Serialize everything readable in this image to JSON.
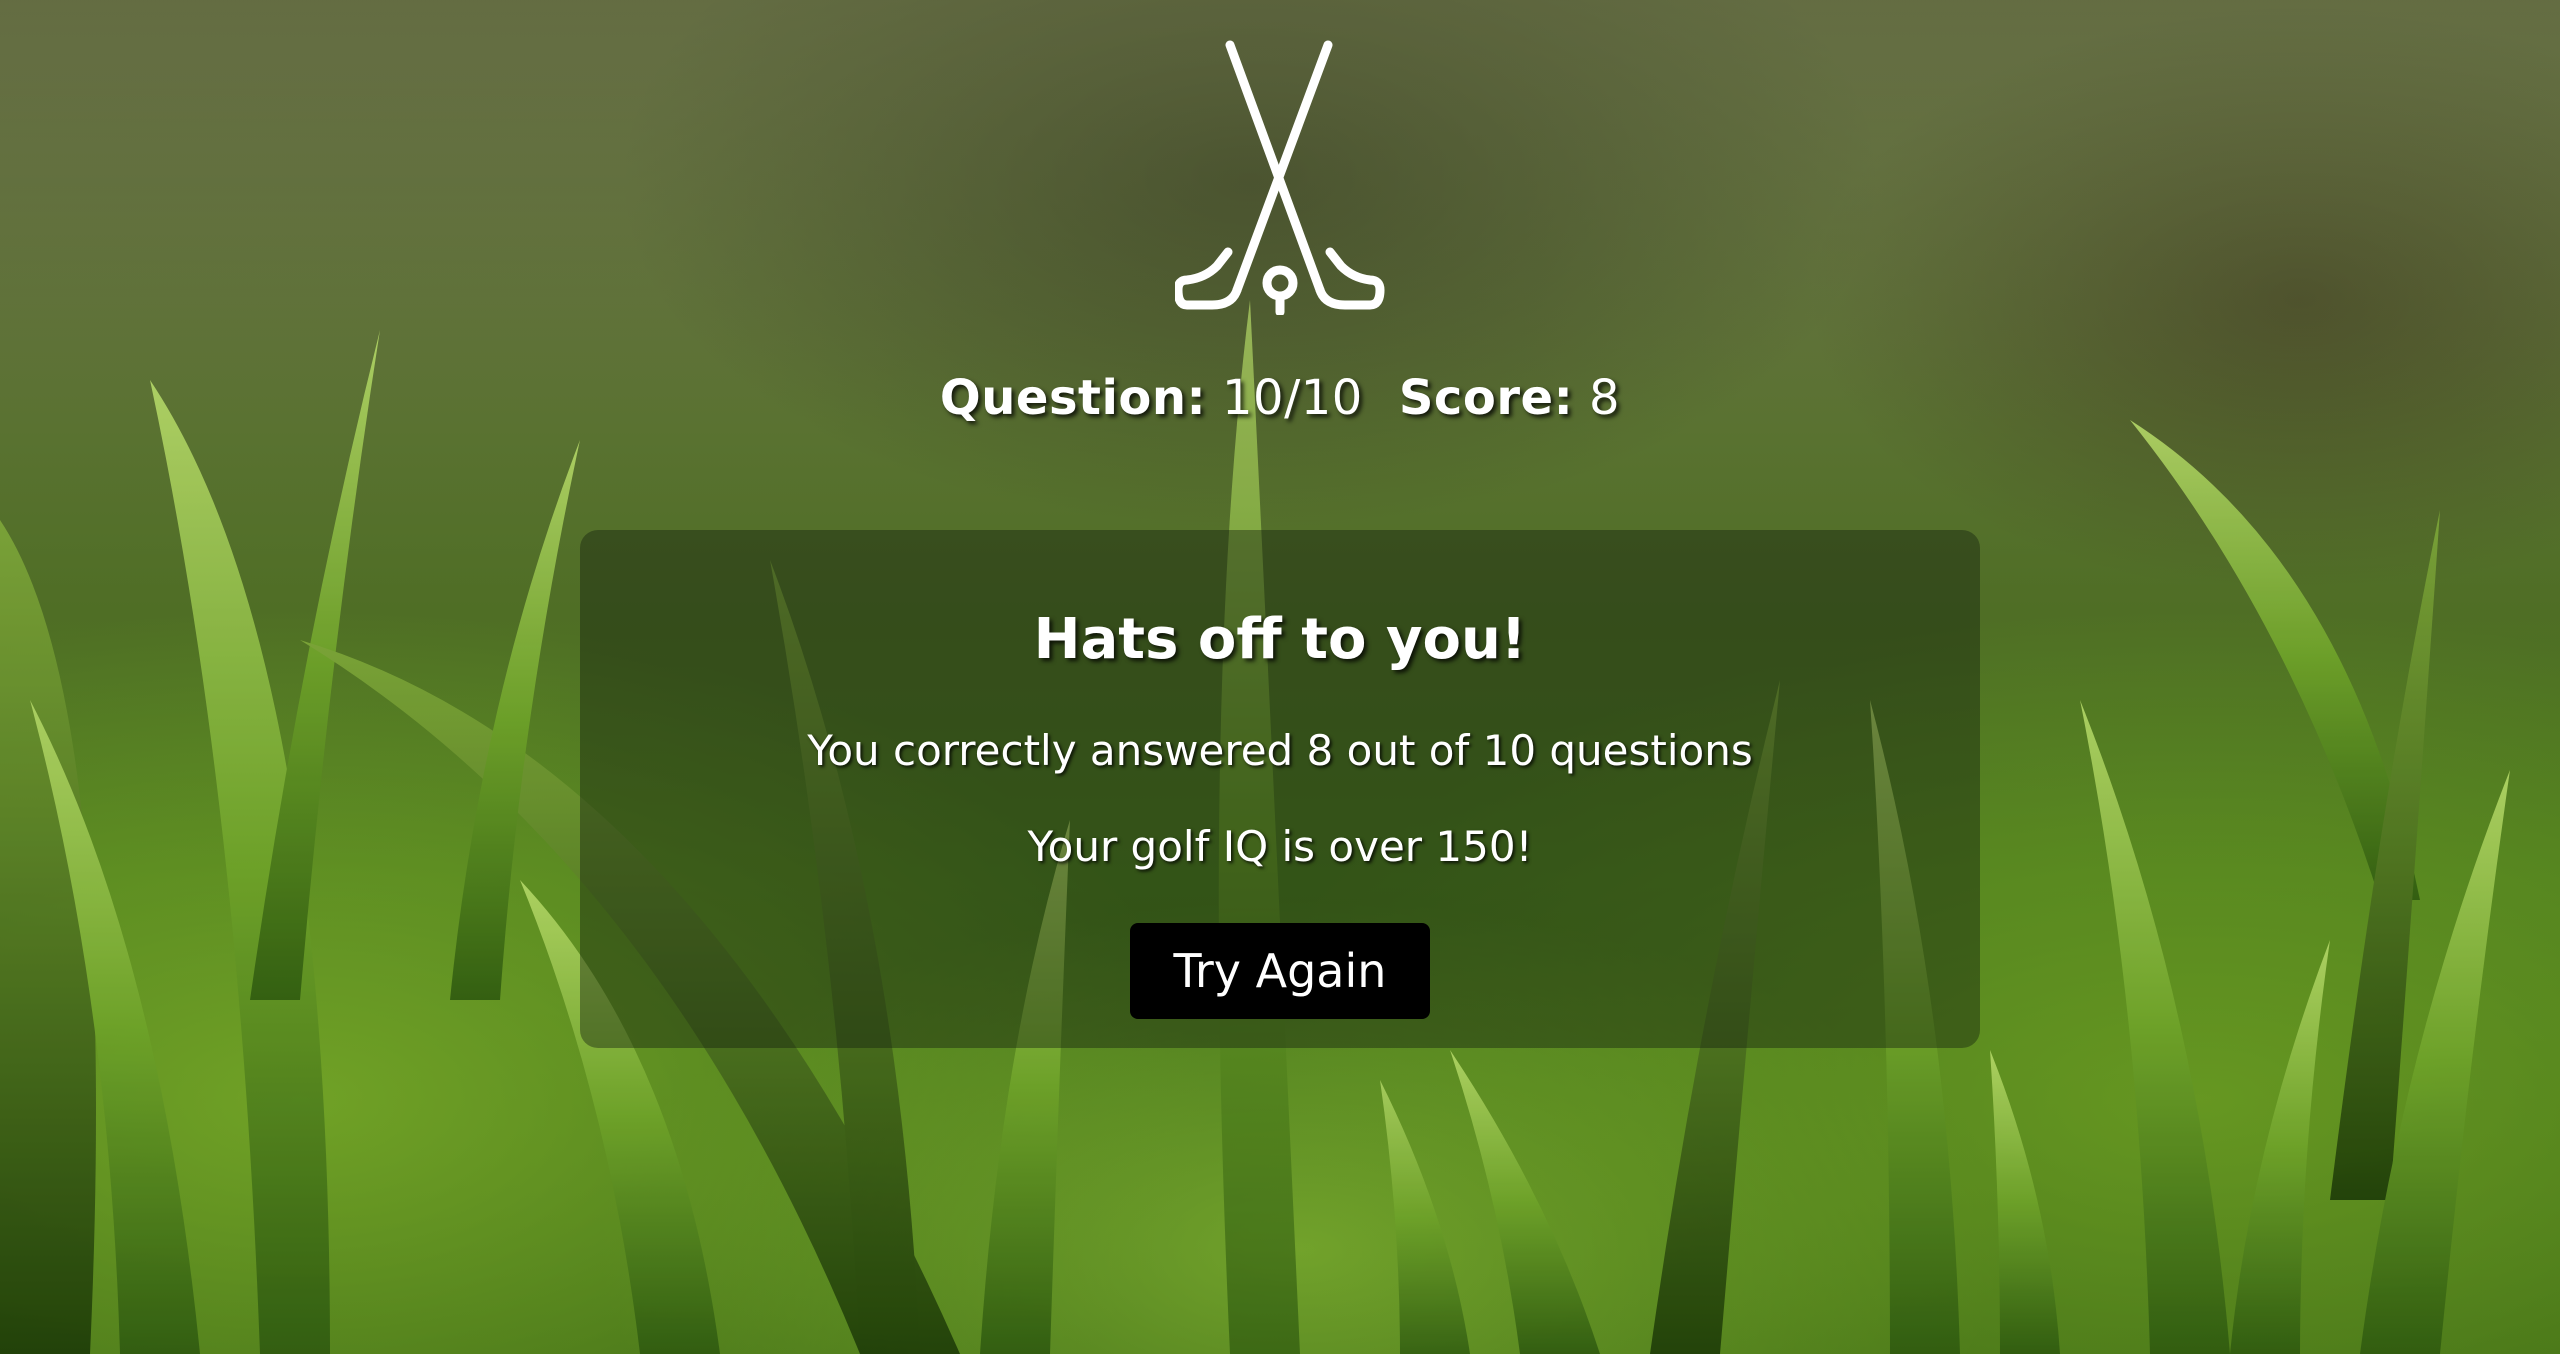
{
  "header": {
    "logo_icon": "crossed-golf-clubs-icon",
    "question_label": "Question:",
    "question_value": "10/10",
    "score_label": "Score:",
    "score_value": "8"
  },
  "result": {
    "headline": "Hats off to you!",
    "summary": "You correctly answered 8 out of 10 questions",
    "iq_message": "Your golf IQ is over 150!",
    "try_again_label": "Try Again"
  },
  "colors": {
    "text": "#ffffff",
    "button_bg": "#000000",
    "panel_bg": "rgba(20,30,15,0.42)"
  }
}
